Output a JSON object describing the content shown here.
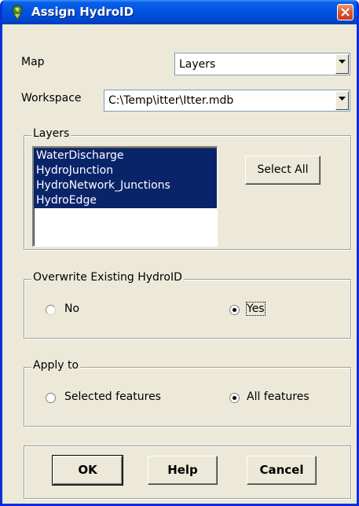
{
  "window": {
    "title": "Assign HydroID"
  },
  "map": {
    "label": "Map",
    "value": "Layers"
  },
  "workspace": {
    "label": "Workspace",
    "value": "C:\\Temp\\itter\\Itter.mdb"
  },
  "layers": {
    "legend": "Layers",
    "items": [
      "WaterDischarge",
      "HydroJunction",
      "HydroNetwork_Junctions",
      "HydroEdge"
    ],
    "select_all_label": "Select All"
  },
  "overwrite": {
    "legend": "Overwrite Existing HydroID",
    "options": [
      {
        "label": "No",
        "checked": false
      },
      {
        "label": "Yes",
        "checked": true
      }
    ]
  },
  "apply_to": {
    "legend": "Apply to",
    "options": [
      {
        "label": "Selected features",
        "checked": false
      },
      {
        "label": "All features",
        "checked": true
      }
    ]
  },
  "buttons": {
    "ok": "OK",
    "help": "Help",
    "cancel": "Cancel"
  },
  "colors": {
    "titlebar": "#0055e5",
    "selection": "#0a246a",
    "dialog_bg": "#ece9d8"
  }
}
